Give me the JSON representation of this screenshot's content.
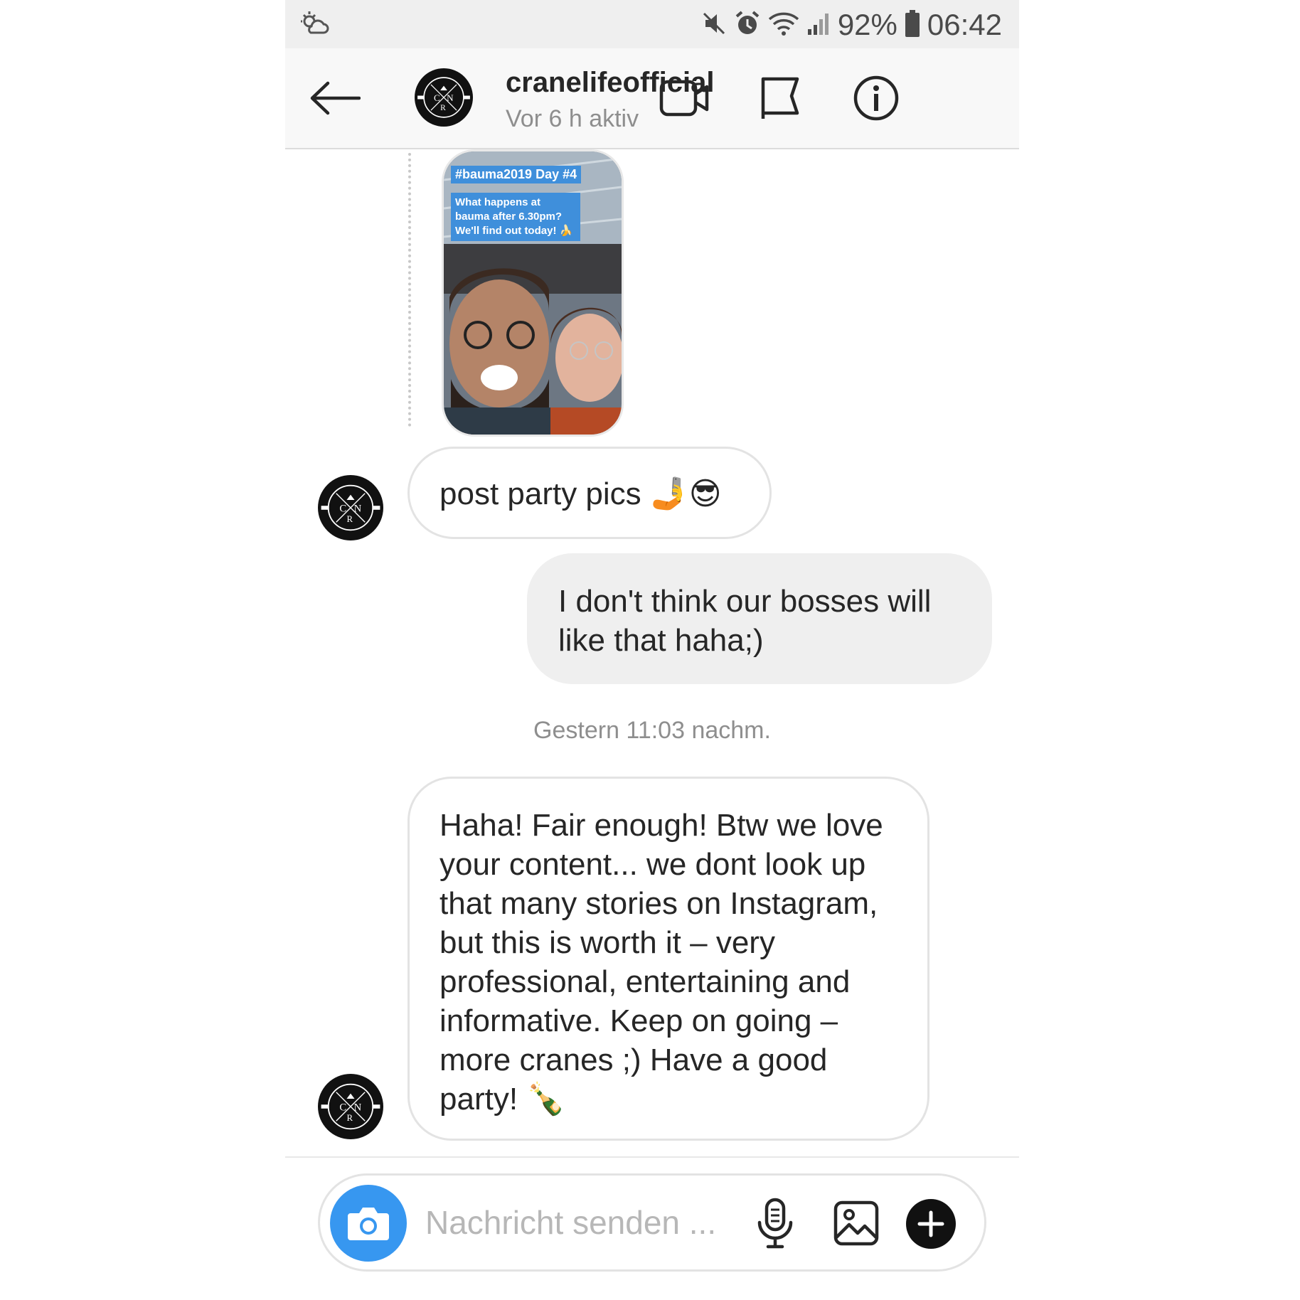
{
  "status_bar": {
    "battery_percent": "92%",
    "time": "06:42",
    "icons": [
      "weather-icon",
      "mute-icon",
      "alarm-icon",
      "wifi-icon",
      "signal-icon",
      "battery-icon"
    ]
  },
  "header": {
    "username": "cranelifeofficial",
    "activity": "Vor 6 h aktiv",
    "icons": [
      "back-arrow-icon",
      "video-call-icon",
      "flag-icon",
      "info-icon"
    ]
  },
  "story_reply": {
    "caption_title": "#bauma2019 Day #4",
    "caption_text": "What happens at bauma after 6.30pm? We'll find out today! 🍌"
  },
  "messages": [
    {
      "direction": "incoming",
      "text": "post party pics 🤳😎"
    },
    {
      "direction": "outgoing",
      "text": "I don't think our bosses will like that haha;)"
    },
    {
      "direction": "timestamp",
      "text": "Gestern 11:03 nachm."
    },
    {
      "direction": "incoming",
      "text": "Haha! Fair enough! Btw we love your content... we dont look up that many stories on Instagram, but this is worth it – very professional, entertaining and informative. Keep on going – more cranes ;) Have a good party! 🍾"
    }
  ],
  "composer": {
    "placeholder": "Nachricht senden ...",
    "icons": [
      "camera-icon",
      "microphone-icon",
      "gallery-icon",
      "plus-icon"
    ]
  },
  "colors": {
    "accent_blue": "#3797f0",
    "outgoing_bubble": "#efefef",
    "secondary_text": "#8e8e8e"
  }
}
